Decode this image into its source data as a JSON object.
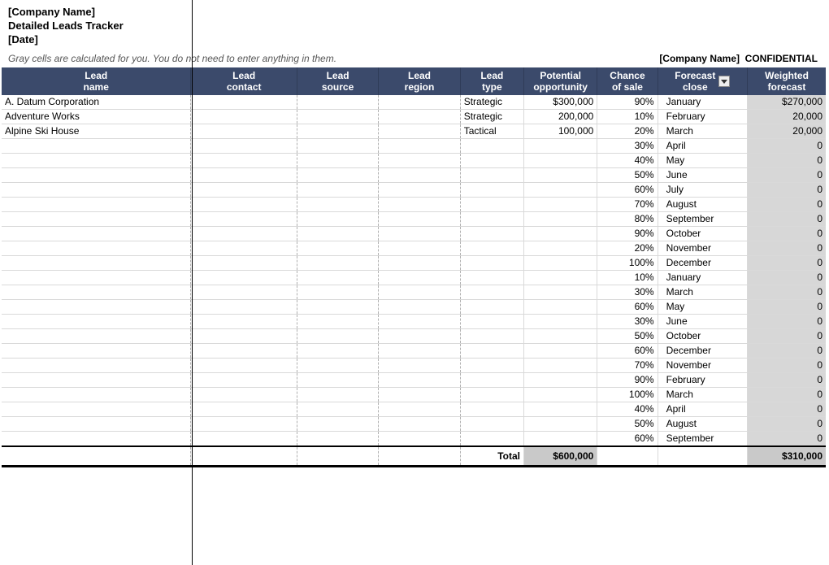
{
  "header": {
    "company": "[Company Name]",
    "title": "Detailed Leads Tracker",
    "date": "[Date]",
    "hint": "Gray cells are calculated for you. You do not need to enter anything in them.",
    "confidential_company": "[Company Name]",
    "confidential_label": "CONFIDENTIAL"
  },
  "columns": {
    "lead_name_l1": "Lead",
    "lead_name_l2": "name",
    "contact_l1": "Lead",
    "contact_l2": "contact",
    "source_l1": "Lead",
    "source_l2": "source",
    "region_l1": "Lead",
    "region_l2": "region",
    "type_l1": "Lead",
    "type_l2": "type",
    "potential_l1": "Potential",
    "potential_l2": "opportunity",
    "chance_l1": "Chance",
    "chance_l2": "of sale",
    "forecast_l1": "Forecast",
    "forecast_l2": "close",
    "weighted_l1": "Weighted",
    "weighted_l2": "forecast"
  },
  "rows": [
    {
      "lead_name": "A. Datum Corporation",
      "contact": "",
      "source": "",
      "region": "",
      "type": "Strategic",
      "potential": "$300,000",
      "chance": "90%",
      "forecast": "January",
      "weighted": "$270,000"
    },
    {
      "lead_name": "Adventure Works",
      "contact": "",
      "source": "",
      "region": "",
      "type": "Strategic",
      "potential": "200,000",
      "chance": "10%",
      "forecast": "February",
      "weighted": "20,000"
    },
    {
      "lead_name": "Alpine Ski House",
      "contact": "",
      "source": "",
      "region": "",
      "type": "Tactical",
      "potential": "100,000",
      "chance": "20%",
      "forecast": "March",
      "weighted": "20,000"
    },
    {
      "lead_name": "",
      "contact": "",
      "source": "",
      "region": "",
      "type": "",
      "potential": "",
      "chance": "30%",
      "forecast": "April",
      "weighted": "0"
    },
    {
      "lead_name": "",
      "contact": "",
      "source": "",
      "region": "",
      "type": "",
      "potential": "",
      "chance": "40%",
      "forecast": "May",
      "weighted": "0"
    },
    {
      "lead_name": "",
      "contact": "",
      "source": "",
      "region": "",
      "type": "",
      "potential": "",
      "chance": "50%",
      "forecast": "June",
      "weighted": "0"
    },
    {
      "lead_name": "",
      "contact": "",
      "source": "",
      "region": "",
      "type": "",
      "potential": "",
      "chance": "60%",
      "forecast": "July",
      "weighted": "0"
    },
    {
      "lead_name": "",
      "contact": "",
      "source": "",
      "region": "",
      "type": "",
      "potential": "",
      "chance": "70%",
      "forecast": "August",
      "weighted": "0"
    },
    {
      "lead_name": "",
      "contact": "",
      "source": "",
      "region": "",
      "type": "",
      "potential": "",
      "chance": "80%",
      "forecast": "September",
      "weighted": "0"
    },
    {
      "lead_name": "",
      "contact": "",
      "source": "",
      "region": "",
      "type": "",
      "potential": "",
      "chance": "90%",
      "forecast": "October",
      "weighted": "0"
    },
    {
      "lead_name": "",
      "contact": "",
      "source": "",
      "region": "",
      "type": "",
      "potential": "",
      "chance": "20%",
      "forecast": "November",
      "weighted": "0"
    },
    {
      "lead_name": "",
      "contact": "",
      "source": "",
      "region": "",
      "type": "",
      "potential": "",
      "chance": "100%",
      "forecast": "December",
      "weighted": "0"
    },
    {
      "lead_name": "",
      "contact": "",
      "source": "",
      "region": "",
      "type": "",
      "potential": "",
      "chance": "10%",
      "forecast": "January",
      "weighted": "0"
    },
    {
      "lead_name": "",
      "contact": "",
      "source": "",
      "region": "",
      "type": "",
      "potential": "",
      "chance": "30%",
      "forecast": "March",
      "weighted": "0"
    },
    {
      "lead_name": "",
      "contact": "",
      "source": "",
      "region": "",
      "type": "",
      "potential": "",
      "chance": "60%",
      "forecast": "May",
      "weighted": "0"
    },
    {
      "lead_name": "",
      "contact": "",
      "source": "",
      "region": "",
      "type": "",
      "potential": "",
      "chance": "30%",
      "forecast": "June",
      "weighted": "0"
    },
    {
      "lead_name": "",
      "contact": "",
      "source": "",
      "region": "",
      "type": "",
      "potential": "",
      "chance": "50%",
      "forecast": "October",
      "weighted": "0"
    },
    {
      "lead_name": "",
      "contact": "",
      "source": "",
      "region": "",
      "type": "",
      "potential": "",
      "chance": "60%",
      "forecast": "December",
      "weighted": "0"
    },
    {
      "lead_name": "",
      "contact": "",
      "source": "",
      "region": "",
      "type": "",
      "potential": "",
      "chance": "70%",
      "forecast": "November",
      "weighted": "0"
    },
    {
      "lead_name": "",
      "contact": "",
      "source": "",
      "region": "",
      "type": "",
      "potential": "",
      "chance": "90%",
      "forecast": "February",
      "weighted": "0"
    },
    {
      "lead_name": "",
      "contact": "",
      "source": "",
      "region": "",
      "type": "",
      "potential": "",
      "chance": "100%",
      "forecast": "March",
      "weighted": "0"
    },
    {
      "lead_name": "",
      "contact": "",
      "source": "",
      "region": "",
      "type": "",
      "potential": "",
      "chance": "40%",
      "forecast": "April",
      "weighted": "0"
    },
    {
      "lead_name": "",
      "contact": "",
      "source": "",
      "region": "",
      "type": "",
      "potential": "",
      "chance": "50%",
      "forecast": "August",
      "weighted": "0"
    },
    {
      "lead_name": "",
      "contact": "",
      "source": "",
      "region": "",
      "type": "",
      "potential": "",
      "chance": "60%",
      "forecast": "September",
      "weighted": "0"
    }
  ],
  "totals": {
    "label": "Total",
    "potential": "$600,000",
    "weighted": "$310,000"
  }
}
